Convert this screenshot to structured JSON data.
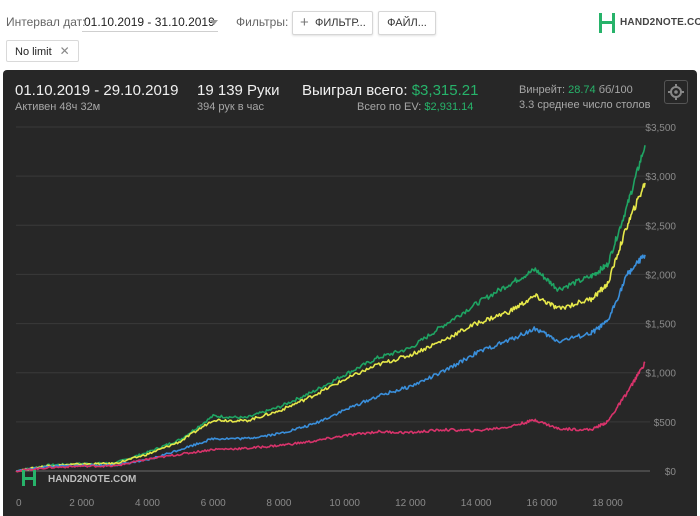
{
  "toolbar": {
    "date_interval_label": "Интервал дат:",
    "date_interval_value": "01.10.2019 - 31.10.2019",
    "filters_label": "Фильтры:",
    "filter_button_label": "ФИЛЬТР...",
    "file_button_label": "ФАЙЛ...",
    "chip_label": "No limit",
    "logo_text": "HAND2NOTE.COM"
  },
  "summary": {
    "date_range": "01.10.2019 - 29.10.2019",
    "active": "Активен 48ч 32м",
    "hands": "19 139 Руки",
    "hands_per_hour": "394 рук в час",
    "won_total_label": "Выиграл всего:",
    "won_total_value": "$3,315.21",
    "ev_label": "Всего по EV:",
    "ev_value": "$2,931.14",
    "winrate_label": "Винрейт:",
    "winrate_value": "28.74",
    "winrate_unit": "бб/100",
    "avg_tables": "3.3 среднее число столов"
  },
  "chart_data": {
    "type": "line",
    "x_ticks": [
      "0",
      "2 000",
      "4 000",
      "6 000",
      "8 000",
      "10 000",
      "12 000",
      "14 000",
      "16 000",
      "18 000"
    ],
    "y_ticks": [
      "$0",
      "$500",
      "$1,000",
      "$1,500",
      "$2,000",
      "$2,500",
      "$3,000",
      "$3,500"
    ],
    "xlim": [
      0,
      19139
    ],
    "ylim": [
      0,
      3500
    ],
    "watermark": "HAND2NOTE.COM",
    "series": [
      {
        "color": "#1fa463",
        "points": [
          [
            0,
            0
          ],
          [
            1000,
            60
          ],
          [
            2000,
            75
          ],
          [
            3000,
            80
          ],
          [
            4000,
            190
          ],
          [
            5000,
            320
          ],
          [
            6000,
            560
          ],
          [
            7000,
            540
          ],
          [
            8000,
            650
          ],
          [
            9000,
            800
          ],
          [
            10000,
            980
          ],
          [
            11000,
            1150
          ],
          [
            12000,
            1250
          ],
          [
            13000,
            1480
          ],
          [
            14000,
            1700
          ],
          [
            15000,
            1900
          ],
          [
            15800,
            2050
          ],
          [
            16500,
            1850
          ],
          [
            17500,
            1980
          ],
          [
            18000,
            2100
          ],
          [
            18600,
            2700
          ],
          [
            19139,
            3315
          ]
        ]
      },
      {
        "color": "#e6e84a",
        "points": [
          [
            0,
            0
          ],
          [
            1000,
            55
          ],
          [
            2000,
            70
          ],
          [
            3000,
            75
          ],
          [
            4000,
            170
          ],
          [
            5000,
            300
          ],
          [
            6000,
            520
          ],
          [
            7000,
            510
          ],
          [
            8000,
            610
          ],
          [
            9000,
            760
          ],
          [
            10000,
            930
          ],
          [
            11000,
            1080
          ],
          [
            12000,
            1180
          ],
          [
            13000,
            1330
          ],
          [
            14000,
            1500
          ],
          [
            15000,
            1620
          ],
          [
            15800,
            1780
          ],
          [
            16500,
            1650
          ],
          [
            17500,
            1750
          ],
          [
            18000,
            1900
          ],
          [
            18600,
            2500
          ],
          [
            19139,
            2931
          ]
        ]
      },
      {
        "color": "#3a8fdb",
        "points": [
          [
            0,
            0
          ],
          [
            1000,
            45
          ],
          [
            2000,
            55
          ],
          [
            3000,
            60
          ],
          [
            4000,
            110
          ],
          [
            5000,
            220
          ],
          [
            6000,
            330
          ],
          [
            7000,
            330
          ],
          [
            8000,
            380
          ],
          [
            9000,
            470
          ],
          [
            10000,
            620
          ],
          [
            11000,
            760
          ],
          [
            12000,
            860
          ],
          [
            13000,
            1010
          ],
          [
            14000,
            1200
          ],
          [
            15000,
            1330
          ],
          [
            15800,
            1450
          ],
          [
            16500,
            1320
          ],
          [
            17500,
            1400
          ],
          [
            18000,
            1520
          ],
          [
            18600,
            2000
          ],
          [
            19139,
            2200
          ]
        ]
      },
      {
        "color": "#d8336b",
        "points": [
          [
            0,
            0
          ],
          [
            1000,
            35
          ],
          [
            2000,
            50
          ],
          [
            3000,
            50
          ],
          [
            4000,
            120
          ],
          [
            5000,
            170
          ],
          [
            6000,
            220
          ],
          [
            7000,
            230
          ],
          [
            8000,
            260
          ],
          [
            9000,
            300
          ],
          [
            10000,
            360
          ],
          [
            11000,
            400
          ],
          [
            12000,
            390
          ],
          [
            13000,
            420
          ],
          [
            14000,
            410
          ],
          [
            15000,
            450
          ],
          [
            15800,
            520
          ],
          [
            16500,
            430
          ],
          [
            17500,
            420
          ],
          [
            18000,
            500
          ],
          [
            18600,
            800
          ],
          [
            19139,
            1100
          ]
        ]
      }
    ]
  }
}
